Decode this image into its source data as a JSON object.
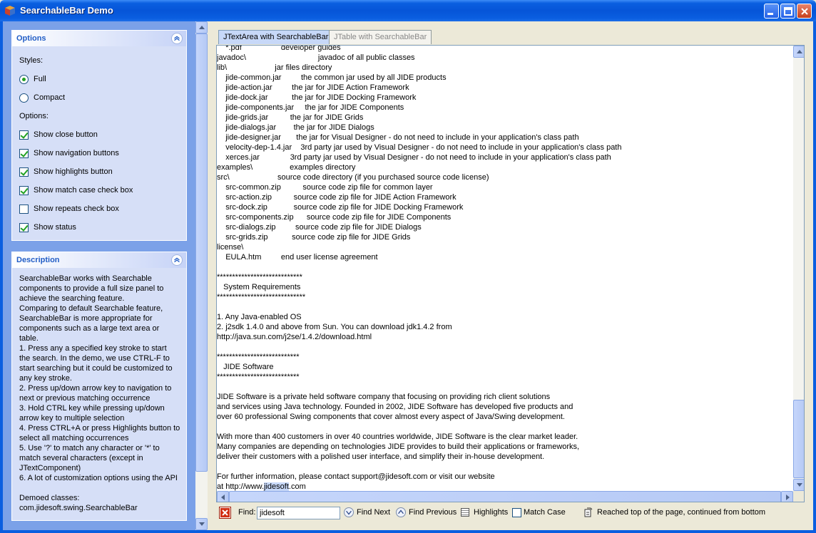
{
  "window": {
    "title": "SearchableBar Demo"
  },
  "options": {
    "header": "Options",
    "styles_label": "Styles:",
    "styles": [
      {
        "label": "Full",
        "selected": true
      },
      {
        "label": "Compact",
        "selected": false
      }
    ],
    "options_label": "Options:",
    "checkboxes": [
      {
        "label": "Show close button",
        "checked": true
      },
      {
        "label": "Show navigation buttons",
        "checked": true
      },
      {
        "label": "Show highlights button",
        "checked": true
      },
      {
        "label": "Show match case check box",
        "checked": true
      },
      {
        "label": "Show repeats check box",
        "checked": false
      },
      {
        "label": "Show status",
        "checked": true
      }
    ]
  },
  "description": {
    "header": "Description",
    "lines": [
      "SearchableBar works with Searchable",
      "components to provide a full size panel to",
      "achieve the searching feature.",
      "Comparing to default Searchable feature,",
      "SearchableBar is more appropriate for",
      "components such as a large text area or",
      "table.",
      "1. Press any a specified key stroke to start",
      "the search. In the demo, we use CTRL-F to",
      "start searching but it could be customized to",
      "any key stroke.",
      "2. Press up/down arrow key to navigation to",
      "next or previous matching occurrence",
      "3. Hold CTRL key while pressing up/down",
      "arrow key to multiple selection",
      "4. Press CTRL+A or press Highlights button to",
      "select all matching occurrences",
      "5. Use '?' to match any character or '*' to",
      "match several characters (except in",
      "JTextComponent)",
      "6. A lot of customization options using the API",
      "",
      "Demoed classes:",
      "com.jidesoft.swing.SearchableBar"
    ]
  },
  "tabs": [
    {
      "label": "JTextArea with SearchableBar",
      "active": true
    },
    {
      "label": "JTable with SearchableBar",
      "active": false
    }
  ],
  "text_area": {
    "lines": [
      "    *.pdf                  developer guides",
      "javadoc\\                                 javadoc of all public classes",
      "lib\\                      jar files directory",
      "    jide-common.jar         the common jar used by all JIDE products",
      "    jide-action.jar         the jar for JIDE Action Framework",
      "    jide-dock.jar           the jar for JIDE Docking Framework",
      "    jide-components.jar     the jar for JIDE Components",
      "    jide-grids.jar          the jar for JIDE Grids",
      "    jide-dialogs.jar        the jar for JIDE Dialogs",
      "    jide-designer.jar       the jar for Visual Designer - do not need to include in your application's class path",
      "    velocity-dep-1.4.jar    3rd party jar used by Visual Designer - do not need to include in your application's class path",
      "    xerces.jar              3rd party jar used by Visual Designer - do not need to include in your application's class path",
      "examples\\                 examples directory",
      "src\\                      source code directory (if you purchased source code license)",
      "    src-common.zip          source code zip file for common layer",
      "    src-action.zip          source code zip file for JIDE Action Framework",
      "    src-dock.zip            source code zip file for JIDE Docking Framework",
      "    src-components.zip      source code zip file for JIDE Components",
      "    src-dialogs.zip         source code zip file for JIDE Dialogs",
      "    src-grids.zip           source code zip file for JIDE Grids",
      "license\\",
      "    EULA.htm         end user license agreement",
      "",
      "****************************",
      "   System Requirements",
      "*****************************",
      "",
      "1. Any Java-enabled OS",
      "2. j2sdk 1.4.0 and above from Sun. You can download jdk1.4.2 from",
      "http://java.sun.com/j2se/1.4.2/download.html",
      "",
      "***************************",
      "   JIDE Software",
      "***************************",
      "",
      "JIDE Software is a private held software company that focusing on providing rich client solutions",
      "and services using Java technology. Founded in 2002, JIDE Software has developed five products and",
      "over 60 professional Swing components that cover almost every aspect of Java/Swing development.",
      "",
      "With more than 400 customers in over 40 countries worldwide, JIDE Software is the clear market leader.",
      "Many companies are depending on technologies JIDE provides to build their applications or frameworks,",
      "deliver their customers with a polished user interface, and simplify their in-house development.",
      "",
      "For further information, please contact support@jidesoft.com or visit our website"
    ],
    "last_line_prefix": "at http://www.",
    "last_line_highlight": "jidesoft",
    "last_line_suffix": ".com"
  },
  "search_bar": {
    "find_label": "Find:",
    "find_value": "jidesoft",
    "find_next": "Find Next",
    "find_previous": "Find Previous",
    "highlights": "Highlights",
    "match_case": "Match Case",
    "match_case_checked": false,
    "status": "Reached top of the page, continued from bottom"
  }
}
